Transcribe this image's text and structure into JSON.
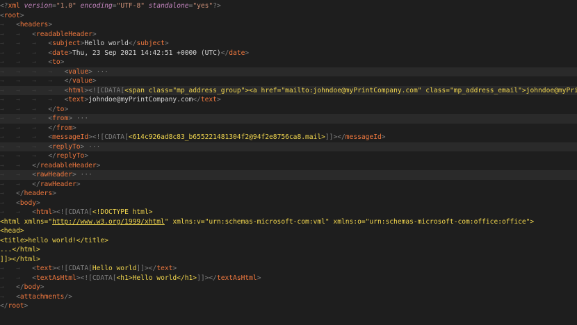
{
  "editor": {
    "lines": [
      {
        "indent": 0,
        "segs": [
          [
            "p",
            "<?"
          ],
          [
            "tg",
            "xml"
          ],
          [
            "t",
            " "
          ],
          [
            "ai",
            "version"
          ],
          [
            "p",
            "="
          ],
          [
            "av",
            "\"1.0\""
          ],
          [
            "t",
            " "
          ],
          [
            "ai",
            "encoding"
          ],
          [
            "p",
            "="
          ],
          [
            "av",
            "\"UTF-8\""
          ],
          [
            "t",
            " "
          ],
          [
            "ai",
            "standalone"
          ],
          [
            "p",
            "="
          ],
          [
            "av",
            "\"yes\""
          ],
          [
            "p",
            "?>"
          ]
        ]
      },
      {
        "indent": 0,
        "segs": [
          [
            "p",
            "<"
          ],
          [
            "tg",
            "root"
          ],
          [
            "p",
            ">"
          ]
        ]
      },
      {
        "indent": 1,
        "segs": [
          [
            "p",
            "<"
          ],
          [
            "tg",
            "headers"
          ],
          [
            "p",
            ">"
          ]
        ]
      },
      {
        "indent": 2,
        "segs": [
          [
            "p",
            "<"
          ],
          [
            "tg",
            "readableHeader"
          ],
          [
            "p",
            ">"
          ]
        ]
      },
      {
        "indent": 3,
        "segs": [
          [
            "p",
            "<"
          ],
          [
            "tg",
            "subject"
          ],
          [
            "p",
            ">"
          ],
          [
            "t",
            "Hello world"
          ],
          [
            "p",
            "</"
          ],
          [
            "tg",
            "subject"
          ],
          [
            "p",
            ">"
          ]
        ]
      },
      {
        "indent": 3,
        "segs": [
          [
            "p",
            "<"
          ],
          [
            "tg",
            "date"
          ],
          [
            "p",
            ">"
          ],
          [
            "t",
            "Thu, 23 Sep 2021 14:42:51 +0000 (UTC)"
          ],
          [
            "p",
            "</"
          ],
          [
            "tg",
            "date"
          ],
          [
            "p",
            ">"
          ]
        ]
      },
      {
        "indent": 3,
        "segs": [
          [
            "p",
            "<"
          ],
          [
            "tg",
            "to"
          ],
          [
            "p",
            ">"
          ]
        ]
      },
      {
        "indent": 4,
        "hl": true,
        "segs": [
          [
            "p",
            "<"
          ],
          [
            "tg",
            "value"
          ],
          [
            "p",
            ">"
          ],
          [
            "c",
            " ···"
          ]
        ]
      },
      {
        "indent": 4,
        "segs": [
          [
            "p",
            "</"
          ],
          [
            "tg",
            "value"
          ],
          [
            "p",
            ">"
          ]
        ]
      },
      {
        "indent": 4,
        "hl": true,
        "segs": [
          [
            "p",
            "<"
          ],
          [
            "tg",
            "html"
          ],
          [
            "p",
            ">"
          ],
          [
            "p",
            "<![CDATA["
          ],
          [
            "ct",
            "<span class=\"mp_address_group\"><a href=\"mailto:johndoe@myPrintCompany.com\" class=\"mp_address_email\">johndoe@myPrintCompany.com</a></span>"
          ],
          [
            "p",
            "]]>"
          ]
        ]
      },
      {
        "indent": 4,
        "segs": [
          [
            "p",
            "<"
          ],
          [
            "tg",
            "text"
          ],
          [
            "p",
            ">"
          ],
          [
            "t",
            "johndoe@myPrintCompany.com"
          ],
          [
            "p",
            "</"
          ],
          [
            "tg",
            "text"
          ],
          [
            "p",
            ">"
          ]
        ]
      },
      {
        "indent": 3,
        "segs": [
          [
            "p",
            "</"
          ],
          [
            "tg",
            "to"
          ],
          [
            "p",
            ">"
          ]
        ]
      },
      {
        "indent": 3,
        "hl": true,
        "segs": [
          [
            "p",
            "<"
          ],
          [
            "tg",
            "from"
          ],
          [
            "p",
            ">"
          ],
          [
            "c",
            " ···"
          ]
        ]
      },
      {
        "indent": 3,
        "segs": [
          [
            "p",
            "</"
          ],
          [
            "tg",
            "from"
          ],
          [
            "p",
            ">"
          ]
        ]
      },
      {
        "indent": 3,
        "segs": [
          [
            "p",
            "<"
          ],
          [
            "tg",
            "messageId"
          ],
          [
            "p",
            ">"
          ],
          [
            "p",
            "<![CDATA["
          ],
          [
            "ct",
            "<614c926ad8c83_b655221481304f2@94f2e8756ca8.mail>"
          ],
          [
            "p",
            "]]>"
          ],
          [
            "p",
            "</"
          ],
          [
            "tg",
            "messageId"
          ],
          [
            "p",
            ">"
          ]
        ]
      },
      {
        "indent": 3,
        "hl": true,
        "segs": [
          [
            "p",
            "<"
          ],
          [
            "tg",
            "replyTo"
          ],
          [
            "p",
            ">"
          ],
          [
            "c",
            " ···"
          ]
        ]
      },
      {
        "indent": 3,
        "segs": [
          [
            "p",
            "</"
          ],
          [
            "tg",
            "replyTo"
          ],
          [
            "p",
            ">"
          ]
        ]
      },
      {
        "indent": 2,
        "segs": [
          [
            "p",
            "</"
          ],
          [
            "tg",
            "readableHeader"
          ],
          [
            "p",
            ">"
          ]
        ]
      },
      {
        "indent": 2,
        "hl": true,
        "segs": [
          [
            "p",
            "<"
          ],
          [
            "tg",
            "rawHeader"
          ],
          [
            "p",
            ">"
          ],
          [
            "c",
            " ···"
          ]
        ]
      },
      {
        "indent": 2,
        "segs": [
          [
            "p",
            "</"
          ],
          [
            "tg",
            "rawHeader"
          ],
          [
            "p",
            ">"
          ]
        ]
      },
      {
        "indent": 1,
        "segs": [
          [
            "p",
            "</"
          ],
          [
            "tg",
            "headers"
          ],
          [
            "p",
            ">"
          ]
        ]
      },
      {
        "indent": 1,
        "segs": [
          [
            "p",
            "<"
          ],
          [
            "tg",
            "body"
          ],
          [
            "p",
            ">"
          ]
        ]
      },
      {
        "indent": 2,
        "segs": [
          [
            "p",
            "<"
          ],
          [
            "tg",
            "html"
          ],
          [
            "p",
            ">"
          ],
          [
            "p",
            "<![CDATA["
          ],
          [
            "ct",
            "<!DOCTYPE html>"
          ]
        ]
      },
      {
        "indent": 0,
        "segs": [
          [
            "ct",
            "<html xmlns=\""
          ],
          [
            "ln",
            "http://www.w3.org/1999/xhtml"
          ],
          [
            "ct",
            "\" xmlns:v=\"urn:schemas-microsoft-com:vml\" xmlns:o=\"urn:schemas-microsoft-com:office:office\">"
          ]
        ]
      },
      {
        "indent": 0,
        "segs": [
          [
            "ct",
            "<head>"
          ]
        ]
      },
      {
        "indent": 0,
        "segs": [
          [
            "ct",
            "<title>hello world!</title>"
          ]
        ]
      },
      {
        "indent": 0,
        "segs": [
          [
            "ct",
            "...</html>"
          ]
        ]
      },
      {
        "indent": 0,
        "segs": [
          [
            "ct",
            "]]></html>"
          ]
        ]
      },
      {
        "indent": 2,
        "segs": [
          [
            "p",
            "<"
          ],
          [
            "tg",
            "text"
          ],
          [
            "p",
            ">"
          ],
          [
            "p",
            "<![CDATA["
          ],
          [
            "ct",
            "Hello world"
          ],
          [
            "p",
            "]]>"
          ],
          [
            "p",
            "</"
          ],
          [
            "tg",
            "text"
          ],
          [
            "p",
            ">"
          ]
        ]
      },
      {
        "indent": 2,
        "segs": [
          [
            "p",
            "<"
          ],
          [
            "tg",
            "textAsHtml"
          ],
          [
            "p",
            ">"
          ],
          [
            "p",
            "<![CDATA["
          ],
          [
            "ct",
            "<h1>Hello world</h1>"
          ],
          [
            "p",
            "]]>"
          ],
          [
            "p",
            "</"
          ],
          [
            "tg",
            "textAsHtml"
          ],
          [
            "p",
            ">"
          ]
        ]
      },
      {
        "indent": 1,
        "segs": [
          [
            "p",
            "</"
          ],
          [
            "tg",
            "body"
          ],
          [
            "p",
            ">"
          ]
        ]
      },
      {
        "indent": 1,
        "segs": [
          [
            "p",
            "<"
          ],
          [
            "tg",
            "attachments"
          ],
          [
            "p",
            "/>"
          ]
        ]
      },
      {
        "indent": 0,
        "segs": [
          [
            "p",
            "</"
          ],
          [
            "tg",
            "root"
          ],
          [
            "p",
            ">"
          ]
        ]
      }
    ]
  },
  "colors": {
    "background": "#1e1e1e",
    "tag": "#f2793f",
    "punctuation": "#808080",
    "attribute_value": "#ce9178",
    "cdata_text": "#f0d54e",
    "indent_guide": "#3c3c3c"
  }
}
